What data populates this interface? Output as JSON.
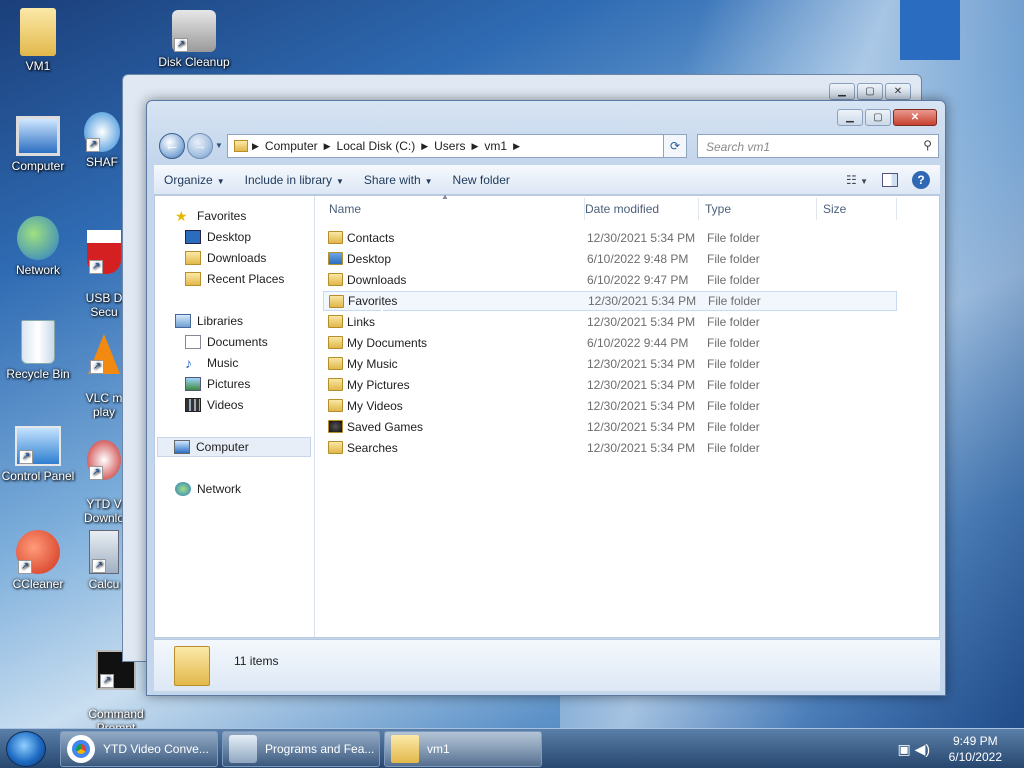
{
  "desktop": {
    "icons": [
      {
        "label": "VM1"
      },
      {
        "label": "Disk Cleanup"
      },
      {
        "label": "Computer"
      },
      {
        "label": "SHAF"
      },
      {
        "label": "Network"
      },
      {
        "label": "USB D\nSecu"
      },
      {
        "label": "Recycle Bin"
      },
      {
        "label": "VLC m\nplay"
      },
      {
        "label": "Control Panel"
      },
      {
        "label": "YTD V\nDownlo"
      },
      {
        "label": "CCleaner"
      },
      {
        "label": "Calcu"
      },
      {
        "label": "Command\nPrompt"
      }
    ]
  },
  "explorer": {
    "breadcrumb": [
      "Computer",
      "Local Disk (C:)",
      "Users",
      "vm1"
    ],
    "search_placeholder": "Search vm1",
    "toolbar": {
      "organize": "Organize",
      "include": "Include in library",
      "share": "Share with",
      "new_folder": "New folder"
    },
    "nav": {
      "favorites": "Favorites",
      "desktop": "Desktop",
      "downloads": "Downloads",
      "recent": "Recent Places",
      "libraries": "Libraries",
      "documents": "Documents",
      "music": "Music",
      "pictures": "Pictures",
      "videos": "Videos",
      "computer": "Computer",
      "network": "Network"
    },
    "columns": {
      "name": "Name",
      "date": "Date modified",
      "type": "Type",
      "size": "Size"
    },
    "files": [
      {
        "name": "Contacts",
        "date": "12/30/2021 5:34 PM",
        "type": "File folder"
      },
      {
        "name": "Desktop",
        "date": "6/10/2022 9:48 PM",
        "type": "File folder"
      },
      {
        "name": "Downloads",
        "date": "6/10/2022 9:47 PM",
        "type": "File folder"
      },
      {
        "name": "Favorites",
        "date": "12/30/2021 5:34 PM",
        "type": "File folder"
      },
      {
        "name": "Links",
        "date": "12/30/2021 5:34 PM",
        "type": "File folder"
      },
      {
        "name": "My Documents",
        "date": "6/10/2022 9:44 PM",
        "type": "File folder"
      },
      {
        "name": "My Music",
        "date": "12/30/2021 5:34 PM",
        "type": "File folder"
      },
      {
        "name": "My Pictures",
        "date": "12/30/2021 5:34 PM",
        "type": "File folder"
      },
      {
        "name": "My Videos",
        "date": "12/30/2021 5:34 PM",
        "type": "File folder"
      },
      {
        "name": "Saved Games",
        "date": "12/30/2021 5:34 PM",
        "type": "File folder"
      },
      {
        "name": "Searches",
        "date": "12/30/2021 5:34 PM",
        "type": "File folder"
      }
    ],
    "status": "11 items"
  },
  "taskbar": {
    "items": [
      {
        "label": "YTD Video Conve..."
      },
      {
        "label": "Programs and Fea..."
      },
      {
        "label": "vm1"
      }
    ],
    "time": "9:49 PM",
    "date": "6/10/2022"
  },
  "colors": {
    "accent": "#3a6ea5",
    "selection": "#cce8ff"
  }
}
